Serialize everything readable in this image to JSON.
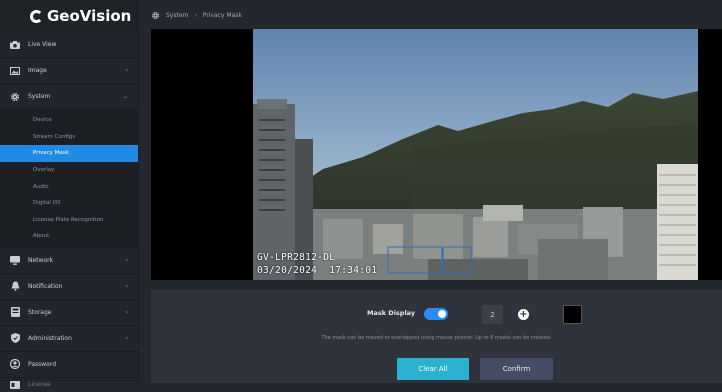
{
  "brand": {
    "logo_text": "GeoVision"
  },
  "sidebar": {
    "items": [
      {
        "label": "Live View",
        "icon": "camera-icon"
      },
      {
        "label": "Image",
        "icon": "image-icon",
        "has_children": true
      },
      {
        "label": "System",
        "icon": "gear-icon",
        "expanded": true
      },
      {
        "label": "Network",
        "icon": "monitor-icon",
        "has_children": true
      },
      {
        "label": "Notification",
        "icon": "bell-icon",
        "has_children": true
      },
      {
        "label": "Storage",
        "icon": "storage-icon",
        "has_children": true
      },
      {
        "label": "Administration",
        "icon": "shield-icon",
        "has_children": true
      },
      {
        "label": "Password",
        "icon": "user-icon"
      },
      {
        "label": "License",
        "icon": "license-icon"
      }
    ],
    "system_subitems": [
      {
        "label": "Device"
      },
      {
        "label": "Stream Configs"
      },
      {
        "label": "Privacy Mask",
        "active": true
      },
      {
        "label": "Overlay"
      },
      {
        "label": "Audio"
      },
      {
        "label": "Digital I/O"
      },
      {
        "label": "License Plate Recognition"
      },
      {
        "label": "About"
      }
    ]
  },
  "breadcrumb": {
    "section": "System",
    "page": "Privacy Mask"
  },
  "video": {
    "camera_name": "GV-LPR2812-DL",
    "timestamp": "03/20/2024  17:34:01"
  },
  "mask_panel": {
    "mask_display_label": "Mask Display",
    "mask_display_on": true,
    "mask_count": "2",
    "mask_color": "#000000",
    "hint": "The mask can be moved or overlapped using mouse pointer. Up to 8 masks can be created.",
    "clear_all_label": "Clear All",
    "confirm_label": "Confirm"
  },
  "colors": {
    "accent": "#1f8be4",
    "clear_button": "#2ab2cf",
    "confirm_button": "#444d63"
  }
}
